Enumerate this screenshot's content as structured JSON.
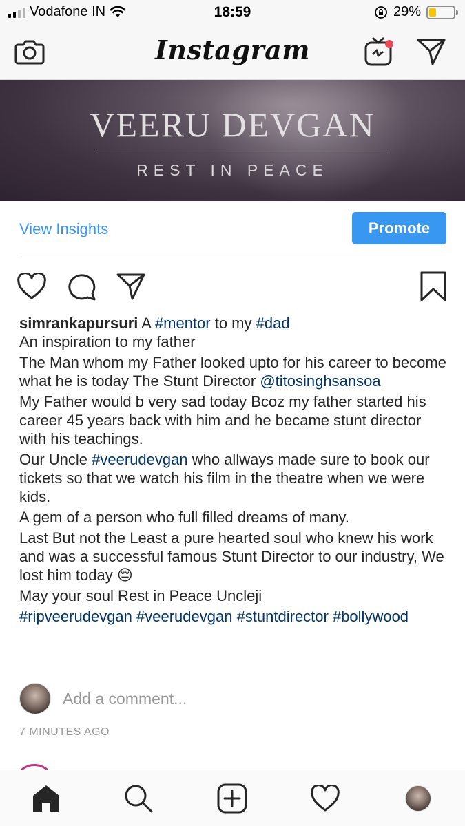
{
  "status_bar": {
    "carrier": "Vodafone IN",
    "time": "18:59",
    "battery_percent": "29%",
    "battery_level": 0.29,
    "signal_bars": 4,
    "signal_active": 2
  },
  "header": {
    "logo_text": "Instagram",
    "left_icon": "camera-icon",
    "right_icons": [
      "igtv-icon",
      "direct-message-icon"
    ],
    "notification_dot_color": "#ed4956"
  },
  "post": {
    "banner_title": "VEERU DEVGAN",
    "banner_subtitle": "REST IN PEACE",
    "view_insights_label": "View Insights",
    "promote_label": "Promote",
    "actions": [
      "heart-icon",
      "comment-icon",
      "share-icon",
      "bookmark-icon"
    ],
    "caption": {
      "username": "simrankapursuri",
      "line1_pre": " A ",
      "line1_tag1": "#mentor",
      "line1_mid": " to my ",
      "line1_tag2": "#dad",
      "para2": "An inspiration to my father",
      "para3_text": "The Man whom my Father looked upto for his career to become what he is today The Stunt Director",
      "para3_mention": "@titosinghsansoa",
      "para4": "My Father would b very sad today Bcoz my father started his career 45 years back with him and he became stunt director with his teachings.",
      "para5_pre": "Our Uncle ",
      "para5_tag": "#veerudevgan",
      "para5_post": " who allways made sure to book our tickets so that we watch his film in the theatre when we were kids.",
      "para6": "A gem of a person who full filled dreams of many.",
      "para7": "Last But not the Least a pure hearted soul who knew his work and was a successful famous Stunt Director to our industry, We lost him today 😔",
      "para8": "May your soul Rest in Peace Uncleji",
      "hashtags": "#ripveerudevgan #veerudevgan #stuntdirector #bollywood"
    },
    "comment_placeholder": "Add a comment...",
    "timestamp": "7 MINUTES AGO"
  },
  "bottom_nav": {
    "items": [
      "home-icon",
      "search-icon",
      "new-post-icon",
      "activity-icon",
      "profile-avatar"
    ]
  },
  "colors": {
    "link_blue": "#3897f0",
    "hashtag_blue": "#003569",
    "text": "#262626",
    "muted": "#999999",
    "battery_yellow": "#f7c600"
  }
}
